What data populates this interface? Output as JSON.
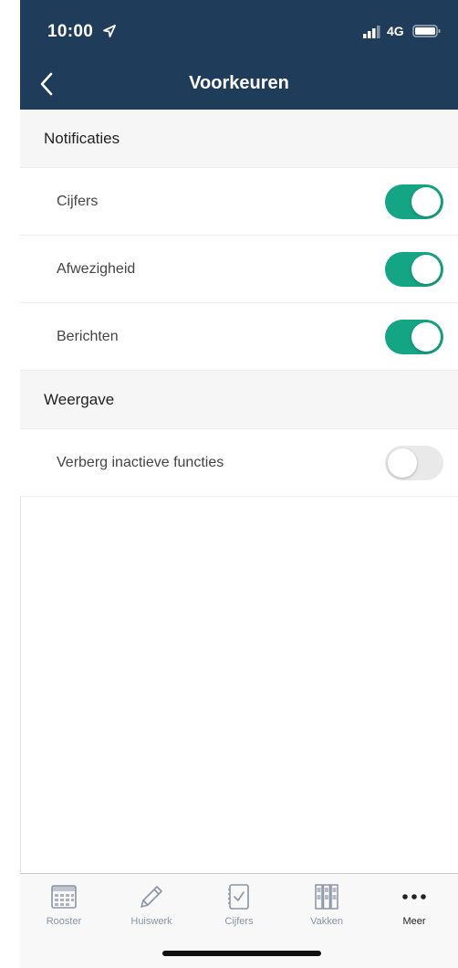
{
  "status_bar": {
    "time": "10:00",
    "network": "4G"
  },
  "nav": {
    "title": "Voorkeuren"
  },
  "sections": [
    {
      "title": "Notificaties",
      "rows": [
        {
          "label": "Cijfers",
          "enabled": true
        },
        {
          "label": "Afwezigheid",
          "enabled": true
        },
        {
          "label": "Berichten",
          "enabled": true
        }
      ]
    },
    {
      "title": "Weergave",
      "rows": [
        {
          "label": "Verberg inactieve functies",
          "enabled": false
        }
      ]
    }
  ],
  "tab_bar": {
    "tabs": [
      {
        "label": "Rooster",
        "icon": "calendar-icon",
        "active": false
      },
      {
        "label": "Huiswerk",
        "icon": "pencil-icon",
        "active": false
      },
      {
        "label": "Cijfers",
        "icon": "gradebook-icon",
        "active": false
      },
      {
        "label": "Vakken",
        "icon": "binders-icon",
        "active": false
      },
      {
        "label": "Meer",
        "icon": "more-icon",
        "active": true
      }
    ]
  },
  "colors": {
    "header_bg": "#1f3c5a",
    "toggle_on": "#14a584",
    "toggle_off": "#e9e9e9",
    "tab_inactive": "#8a94a3",
    "tab_active": "#222222"
  }
}
